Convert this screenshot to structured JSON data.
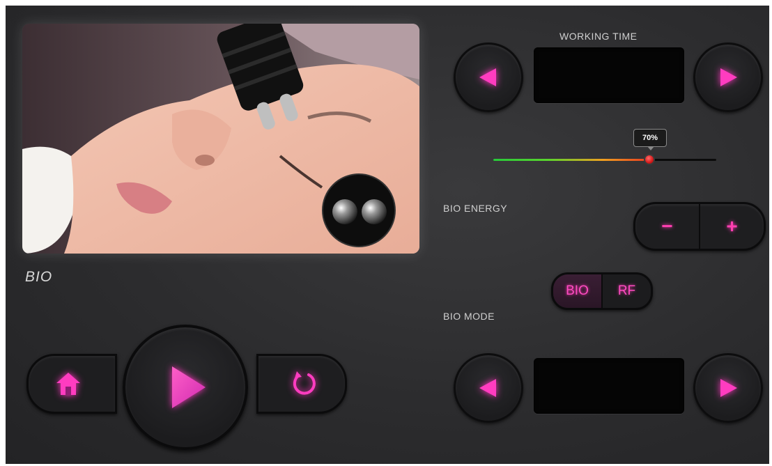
{
  "mode_title": "BIO",
  "working_time": {
    "label": "WORKING TIME",
    "value": ""
  },
  "energy_slider": {
    "value_percent": 70,
    "tooltip": "70%"
  },
  "bio_energy": {
    "label": "BIO ENERGY",
    "minus": "−",
    "plus": "+"
  },
  "bio_mode": {
    "label": "BIO MODE",
    "value": "",
    "options": [
      "BIO",
      "RF"
    ],
    "active": "BIO"
  },
  "icons": {
    "left_arrow": "triangle-left-icon",
    "right_arrow": "triangle-right-icon",
    "home": "home-icon",
    "play": "play-icon",
    "reset": "refresh-icon"
  },
  "colors": {
    "accent": "#ff35c0",
    "accent_dark": "#a12fb0"
  }
}
